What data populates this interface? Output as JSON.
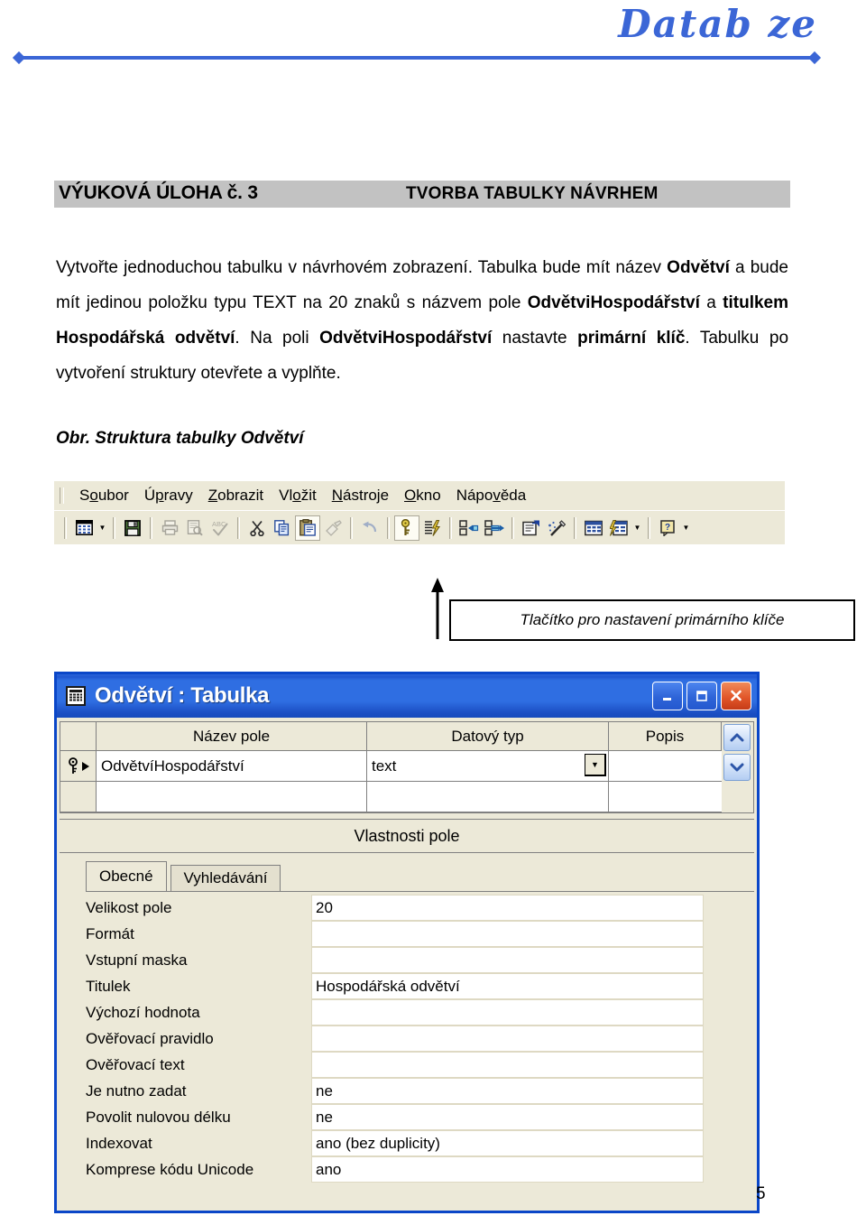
{
  "header": {
    "brand_title": "Datab ze",
    "brand_color": "#3b66d6",
    "left_diamond_icon": "diamond-icon",
    "right_diamond_icon": "diamond-icon"
  },
  "task": {
    "number_label": "VÝUKOVÁ ÚLOHA č. 3",
    "subject_label": "TVORBA TABULKY NÁVRHEM",
    "band_color": "#c2c2c2",
    "body_parts": [
      {
        "text": "Vytvořte jednoduchou tabulku v návrhovém zobrazení. Tabulka bude mít název ",
        "bold": false
      },
      {
        "text": "Odvětví",
        "bold": true
      },
      {
        "text": " a bude mít jedinou položku typu TEXT na 20 znaků s názvem pole ",
        "bold": false
      },
      {
        "text": "OdvětviHospodářství",
        "bold": true
      },
      {
        "text": " a ",
        "bold": false
      },
      {
        "text": "titulkem Hospodářská odvětví",
        "bold": true
      },
      {
        "text": ". Na poli ",
        "bold": false
      },
      {
        "text": "OdvětviHospodářství",
        "bold": true
      },
      {
        "text": " nastavte ",
        "bold": false
      },
      {
        "text": "primární klíč",
        "bold": true
      },
      {
        "text": ". Tabulku po vytvoření struktury otevřete a vyplňte.",
        "bold": false
      }
    ],
    "figure_caption": "Obr. Struktura tabulky Odvětví"
  },
  "access_app": {
    "menu_bar": {
      "items": [
        {
          "before": "S",
          "key": "o",
          "after": "ubor"
        },
        {
          "before": "Ú",
          "key": "p",
          "after": "ravy"
        },
        {
          "before": "",
          "key": "Z",
          "after": "obrazit"
        },
        {
          "before": "Vl",
          "key": "o",
          "after": "žit"
        },
        {
          "before": "",
          "key": "N",
          "after": "ástroje"
        },
        {
          "before": "",
          "key": "O",
          "after": "kno"
        },
        {
          "before": "Nápo",
          "key": "v",
          "after": "ěda"
        }
      ]
    },
    "toolbar": {
      "buttons": [
        {
          "name": "view-design-button",
          "icon": "table-view-icon",
          "state": "enabled",
          "has_dropdown": true
        },
        {
          "name": "save-button",
          "icon": "save-floppy-icon",
          "state": "enabled",
          "has_dropdown": false
        },
        {
          "name": "print-button",
          "icon": "printer-icon",
          "state": "disabled",
          "has_dropdown": false
        },
        {
          "name": "print-preview-button",
          "icon": "print-preview-icon",
          "state": "disabled",
          "has_dropdown": false
        },
        {
          "name": "spelling-button",
          "icon": "spellcheck-abc-icon",
          "state": "disabled",
          "has_dropdown": false
        },
        {
          "name": "cut-button",
          "icon": "scissors-icon",
          "state": "enabled",
          "has_dropdown": false
        },
        {
          "name": "copy-button",
          "icon": "copy-icon",
          "state": "enabled",
          "has_dropdown": false
        },
        {
          "name": "paste-button",
          "icon": "clipboard-paste-icon",
          "state": "pressed",
          "has_dropdown": false
        },
        {
          "name": "format-painter-button",
          "icon": "format-painter-icon",
          "state": "disabled",
          "has_dropdown": false
        },
        {
          "name": "undo-button",
          "icon": "undo-arrow-icon",
          "state": "disabled",
          "has_dropdown": false
        },
        {
          "name": "primary-key-button",
          "icon": "key-icon",
          "state": "pressed",
          "has_dropdown": false
        },
        {
          "name": "indexes-button",
          "icon": "indexes-lightning-icon",
          "state": "enabled",
          "has_dropdown": false
        },
        {
          "name": "insert-rows-button",
          "icon": "insert-rows-icon",
          "state": "enabled",
          "has_dropdown": false
        },
        {
          "name": "delete-rows-button",
          "icon": "delete-rows-icon",
          "state": "enabled",
          "has_dropdown": false
        },
        {
          "name": "properties-button",
          "icon": "properties-sheet-icon",
          "state": "enabled",
          "has_dropdown": false
        },
        {
          "name": "build-button",
          "icon": "build-wand-icon",
          "state": "enabled",
          "has_dropdown": false
        },
        {
          "name": "database-window-button",
          "icon": "database-window-icon",
          "state": "enabled",
          "has_dropdown": false
        },
        {
          "name": "new-object-button",
          "icon": "new-object-icon",
          "state": "enabled",
          "has_dropdown": true
        },
        {
          "name": "help-button",
          "icon": "help-question-icon",
          "state": "enabled",
          "has_dropdown": true
        }
      ]
    },
    "callout": {
      "text": "Tlačítko pro nastavení primárního klíče",
      "arrow_icon": "arrow-up-icon"
    },
    "window": {
      "title": "Odvětví : Tabulka",
      "title_icon": "table-grid-icon",
      "titlebar_color": "#2f6ee2",
      "buttons": {
        "minimize": {
          "name": "minimize-button",
          "icon": "minimize-icon"
        },
        "maximize": {
          "name": "maximize-button",
          "icon": "maximize-icon"
        },
        "close": {
          "name": "close-button",
          "icon": "close-icon"
        }
      },
      "grid": {
        "columns": [
          "Název pole",
          "Datový typ",
          "Popis"
        ],
        "rows": [
          {
            "is_primary_key": true,
            "is_current": true,
            "field_name": "OdvětvíHospodářství",
            "data_type": "text",
            "description": ""
          },
          {
            "is_primary_key": false,
            "is_current": false,
            "field_name": "",
            "data_type": "",
            "description": ""
          }
        ],
        "scroll_up_icon": "chevron-up-icon",
        "scroll_down_icon": "chevron-down-icon",
        "type_dropdown_icon": "chevron-down-icon"
      },
      "properties": {
        "header": "Vlastnosti pole",
        "tabs": [
          {
            "label": "Obecné",
            "active": true
          },
          {
            "label": "Vyhledávání",
            "active": false
          }
        ],
        "rows": [
          {
            "label": "Velikost pole",
            "value": "20"
          },
          {
            "label": "Formát",
            "value": ""
          },
          {
            "label": "Vstupní maska",
            "value": ""
          },
          {
            "label": "Titulek",
            "value": "Hospodářská odvětví"
          },
          {
            "label": "Výchozí hodnota",
            "value": ""
          },
          {
            "label": "Ověřovací pravidlo",
            "value": ""
          },
          {
            "label": "Ověřovací text",
            "value": ""
          },
          {
            "label": "Je nutno zadat",
            "value": "ne"
          },
          {
            "label": "Povolit nulovou délku",
            "value": "ne"
          },
          {
            "label": "Indexovat",
            "value": "ano (bez duplicity)"
          },
          {
            "label": "Komprese kódu Unicode",
            "value": "ano"
          }
        ]
      }
    }
  },
  "footer": {
    "page_number": "5"
  }
}
